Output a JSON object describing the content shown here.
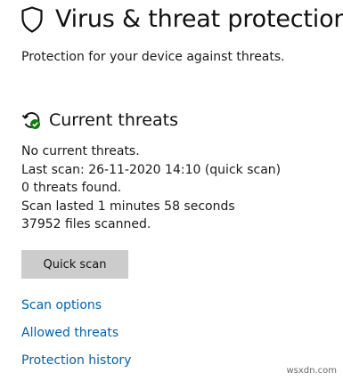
{
  "header": {
    "title": "Virus & threat protection",
    "icon": "shield-icon"
  },
  "subtitle": "Protection for your device against threats.",
  "current_threats": {
    "title": "Current threats",
    "icon": "scan-refresh-icon",
    "status_lines": [
      "No current threats.",
      "Last scan: 26-11-2020 14:10 (quick scan)",
      "0 threats found.",
      "Scan lasted 1 minutes 58 seconds",
      "37952 files scanned."
    ],
    "quick_scan_label": "Quick scan"
  },
  "links": [
    "Scan options",
    "Allowed threats",
    "Protection history"
  ],
  "watermark": "wsxdn.com",
  "colors": {
    "link": "#0063b1",
    "button_bg": "#cccccc",
    "status_ok": "#107c10"
  }
}
